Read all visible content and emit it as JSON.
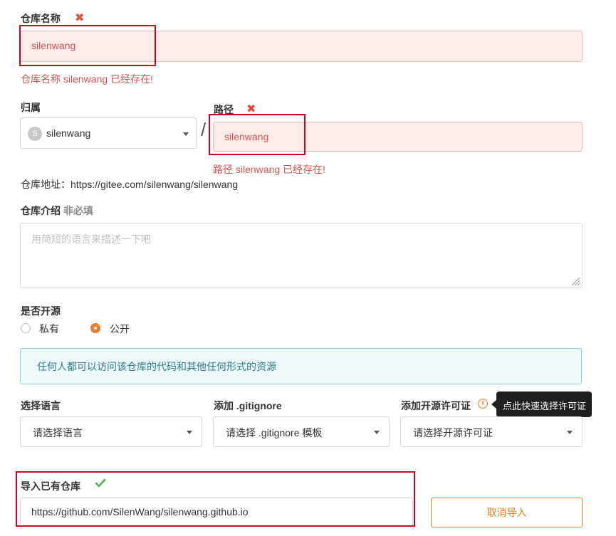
{
  "repo_name": {
    "label": "仓库名称",
    "value": "silenwang",
    "error": "仓库名称 silenwang 已经存在!"
  },
  "owner": {
    "label": "归属",
    "avatar_letter": "S",
    "value": "silenwang"
  },
  "separator": "/",
  "path": {
    "label": "路径",
    "value": "silenwang",
    "error": "路径 silenwang 已经存在!"
  },
  "repo_address": {
    "label": "仓库地址：",
    "url": "https://gitee.com/silenwang/silenwang"
  },
  "description": {
    "label": "仓库介绍",
    "optional": "非必填",
    "placeholder": "用简短的语言来描述一下吧"
  },
  "visibility": {
    "label": "是否开源",
    "options": [
      {
        "label": "私有",
        "selected": false
      },
      {
        "label": "公开",
        "selected": true
      }
    ],
    "info": "任何人都可以访问该仓库的代码和其他任何形式的资源"
  },
  "language": {
    "label": "选择语言",
    "value": "请选择语言"
  },
  "gitignore": {
    "label": "添加 .gitignore",
    "value": "请选择 .gitignore 模板"
  },
  "license": {
    "label": "添加开源许可证",
    "value": "请选择开源许可证",
    "tooltip": "点此快速选择许可证"
  },
  "import": {
    "label": "导入已有仓库",
    "url": "https://github.com/SilenWang/silenwang.github.io",
    "cancel_label": "取消导入"
  },
  "colors": {
    "error": "#d9534f",
    "accent": "#e67e22",
    "success": "#4caf50",
    "highlight_box": "#d0021b"
  }
}
